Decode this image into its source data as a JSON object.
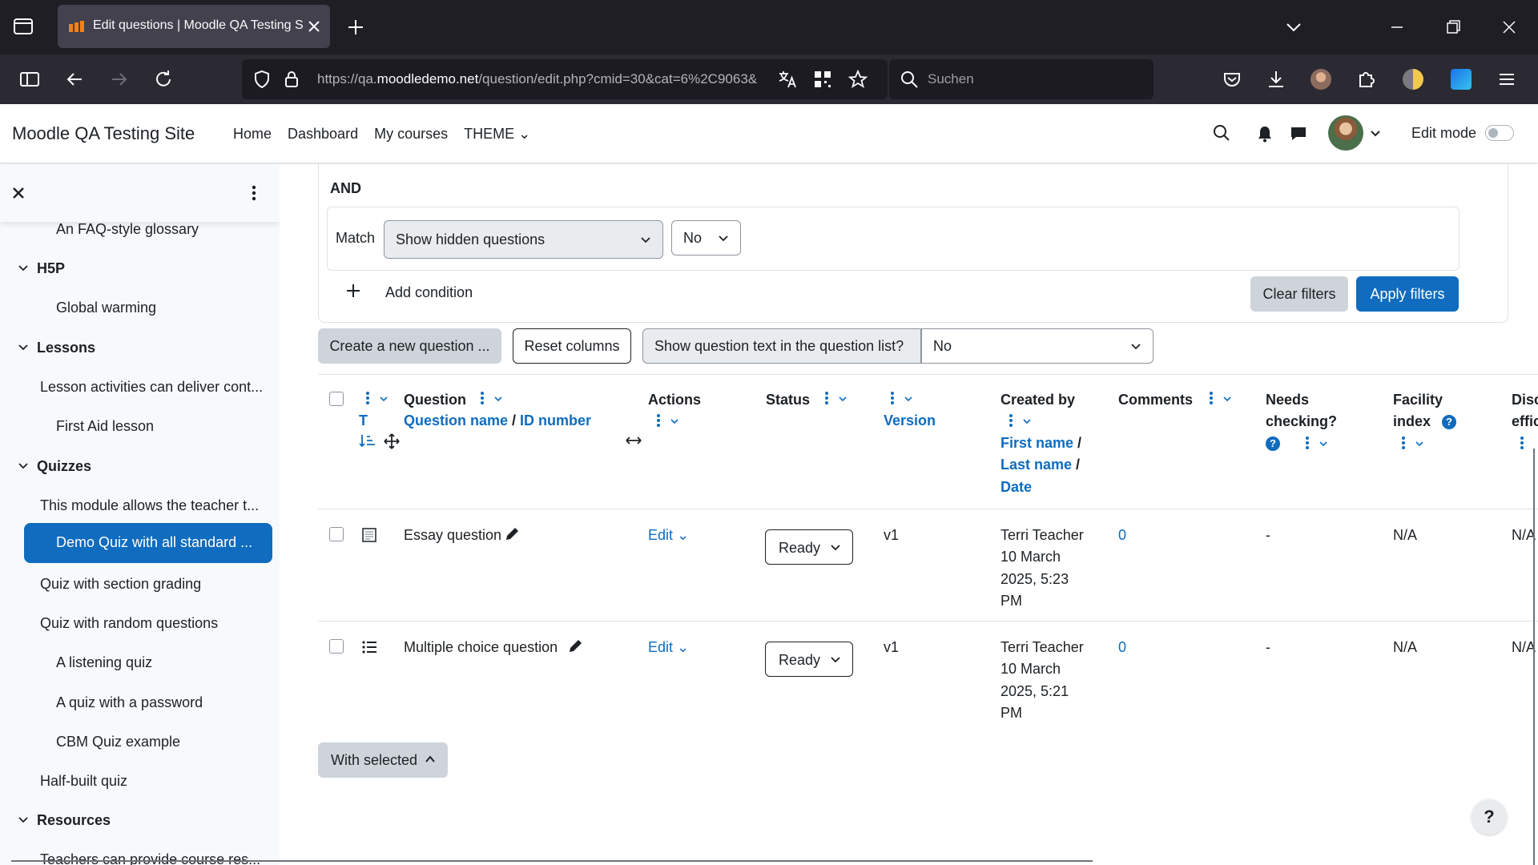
{
  "browser": {
    "tab_title": "Edit questions | Moodle QA Testing Site",
    "url_prefix": "https://qa.",
    "url_domain": "moodledemo.net",
    "url_path": "/question/edit.php?cmid=30&cat=6%2C9063&",
    "search_placeholder": "Suchen"
  },
  "header": {
    "site_name": "Moodle QA Testing Site",
    "nav": [
      "Home",
      "Dashboard",
      "My courses",
      "THEME"
    ],
    "edit_mode": "Edit mode"
  },
  "drawer": {
    "items": [
      {
        "label": "An FAQ-style glossary",
        "type": "item",
        "indent": 2
      },
      {
        "label": "H5P",
        "type": "section"
      },
      {
        "label": "Global warming",
        "type": "item",
        "indent": 2
      },
      {
        "label": "Lessons",
        "type": "section"
      },
      {
        "label": "Lesson activities can deliver cont...",
        "type": "item",
        "indent": 1
      },
      {
        "label": "First Aid lesson",
        "type": "item",
        "indent": 2
      },
      {
        "label": "Quizzes",
        "type": "section"
      },
      {
        "label": "This module allows the teacher t...",
        "type": "item",
        "indent": 1
      },
      {
        "label": "Demo Quiz with all standard ...",
        "type": "active",
        "indent": 2
      },
      {
        "label": "Quiz with section grading",
        "type": "item",
        "indent": 1
      },
      {
        "label": "Quiz with random questions",
        "type": "item",
        "indent": 1
      },
      {
        "label": "A listening quiz",
        "type": "item",
        "indent": 2
      },
      {
        "label": "A quiz with a password",
        "type": "item",
        "indent": 2
      },
      {
        "label": "CBM Quiz example",
        "type": "item",
        "indent": 2
      },
      {
        "label": "Half-built quiz",
        "type": "item",
        "indent": 1
      },
      {
        "label": "Resources",
        "type": "section"
      },
      {
        "label": "Teachers can provide course res...",
        "type": "item",
        "indent": 1
      }
    ]
  },
  "filters": {
    "and_label": "AND",
    "match_label": "Match",
    "condition_select": "Show hidden questions",
    "condition_value": "No",
    "add_condition": "Add condition",
    "clear_filters": "Clear filters",
    "apply_filters": "Apply filters"
  },
  "toolbar": {
    "create_new": "Create a new question ...",
    "reset_columns": "Reset columns",
    "show_text_label": "Show question text in the question list?",
    "show_text_value": "No"
  },
  "table": {
    "headers": {
      "type_short": "T",
      "question": "Question",
      "question_name": "Question name",
      "sep": " / ",
      "id_number": "ID number",
      "actions": "Actions",
      "status": "Status",
      "version": "Version",
      "created_by": "Created by",
      "first_name": "First name",
      "last_name": "Last name",
      "date": "Date",
      "comments": "Comments",
      "needs_checking_1": "Needs",
      "needs_checking_2": "checking?",
      "facility_1": "Facility",
      "facility_2": "index",
      "disc_1": "Disc",
      "disc_2": "effic"
    },
    "rows": [
      {
        "name": "Essay question",
        "action": "Edit",
        "status": "Ready",
        "version": "v1",
        "created_name": "Terri Teacher",
        "created_date_1": "10 March",
        "created_date_2": "2025, 5:23",
        "created_date_3": "PM",
        "comments": "0",
        "needs_checking": "-",
        "facility": "N/A",
        "disc": "N/A"
      },
      {
        "name": "Multiple choice question",
        "action": "Edit",
        "status": "Ready",
        "version": "v1",
        "created_name": "Terri Teacher",
        "created_date_1": "10 March",
        "created_date_2": "2025, 5:21",
        "created_date_3": "PM",
        "comments": "0",
        "needs_checking": "-",
        "facility": "N/A",
        "disc": "N/A"
      }
    ]
  },
  "bulk": {
    "with_selected": "With selected"
  },
  "help_fab": "?",
  "colors": {
    "primary": "#0f6cbf",
    "secondary": "#ced4da",
    "chrome": "#1f1e25"
  }
}
